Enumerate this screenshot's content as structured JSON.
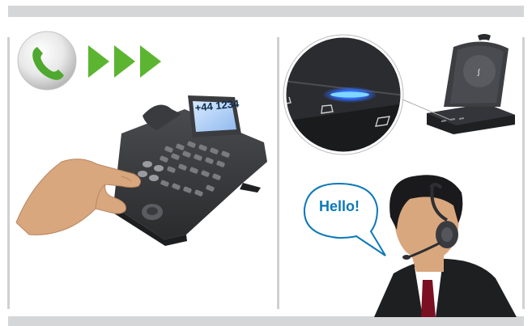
{
  "phone": {
    "display_number": "+44 1234"
  },
  "speech": {
    "text": "Hello!"
  },
  "colors": {
    "band": "#d5d6d8",
    "arrow_green": "#5cb531",
    "phone_icon_green": "#4fa82f",
    "led_blue": "#3a7bff",
    "speech_text": "#0c78b8",
    "skin": "#d9a77e"
  },
  "icons": [
    "phone-call-icon",
    "forward-arrows-icon",
    "handset-icon",
    "mobile-icon"
  ]
}
